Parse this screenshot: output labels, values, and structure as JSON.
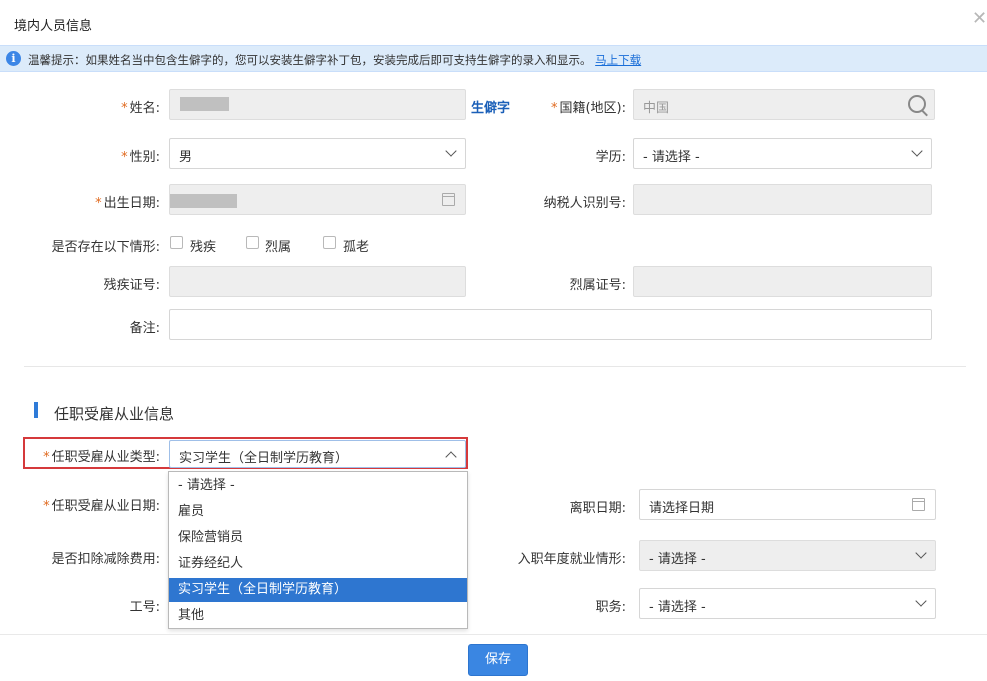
{
  "window": {
    "title": "境内人员信息"
  },
  "tip": {
    "text": "温馨提示：如果姓名当中包含生僻字的，您可以安装生僻字补丁包，安装完成后即可支持生僻字的录入和显示。",
    "link": "马上下载"
  },
  "form": {
    "name_label": "姓名:",
    "rare_char": "生僻字",
    "nationality_label": "国籍(地区):",
    "nationality_value": "中国",
    "gender_label": "性别:",
    "gender_value": "男",
    "education_label": "学历:",
    "education_value": "- 请选择 -",
    "birth_label": "出生日期:",
    "tax_id_label": "纳税人识别号:",
    "situation_label": "是否存在以下情形:",
    "situations": [
      "残疾",
      "烈属",
      "孤老"
    ],
    "disability_label": "残疾证号:",
    "martyr_label": "烈属证号:",
    "remark_label": "备注:"
  },
  "employment": {
    "section_title": "任职受雇从业信息",
    "type_label": "任职受雇从业类型:",
    "type_value": "实习学生（全日制学历教育）",
    "date_label": "任职受雇从业日期:",
    "leave_label": "离职日期:",
    "leave_placeholder": "请选择日期",
    "deduct_label": "是否扣除减除费用:",
    "entry_label": "入职年度就业情形:",
    "entry_value": "- 请选择 -",
    "staff_no_label": "工号:",
    "position_label": "职务:",
    "position_value": "- 请选择 -"
  },
  "dropdown": {
    "options": [
      "- 请选择 -",
      "雇员",
      "保险营销员",
      "证券经纪人",
      "实习学生（全日制学历教育）",
      "其他"
    ],
    "selected_index": 4
  },
  "footer": {
    "save": "保存"
  },
  "colors": {
    "primary": "#3a86e2",
    "required": "#e0691e",
    "highlight": "#d5393b",
    "rare_char": "#1a5fb8"
  }
}
